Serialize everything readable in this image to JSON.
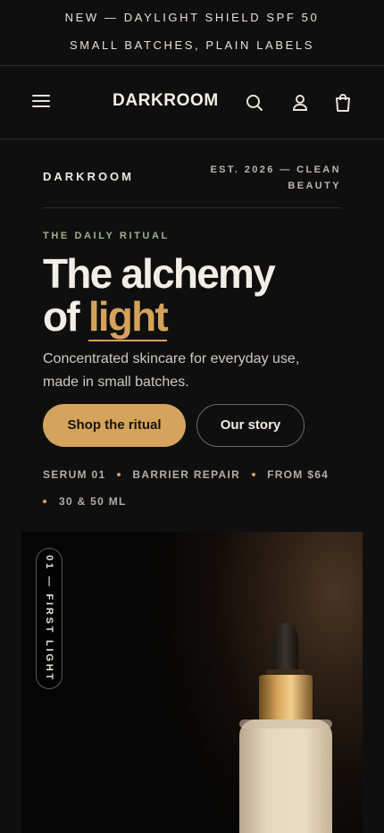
{
  "announcement": {
    "line1": "NEW — DAYLIGHT SHIELD SPF 50",
    "line2": "SMALL BATCHES, PLAIN LABELS"
  },
  "header": {
    "brand": "DARKROOM",
    "icons": [
      "menu-icon",
      "search-icon",
      "account-icon",
      "bag-icon"
    ]
  },
  "intro": {
    "subbrand": "DARKROOM",
    "est": "EST. 2026 — CLEAN BEAUTY"
  },
  "hero": {
    "eyebrow": "THE DAILY RITUAL",
    "headline_line1": "The alchemy",
    "headline_of": "of",
    "headline_accent": "light",
    "lead": "Concentrated skincare for everyday use, made in small batches.",
    "primary_cta": "Shop the ritual",
    "secondary_cta": "Our story",
    "meta": [
      "SERUM 01",
      "BARRIER REPAIR",
      "FROM $64",
      "30 & 50 ML"
    ]
  },
  "visual": {
    "tag": "01 — FIRST LIGHT"
  },
  "colors": {
    "background": "#0f0f10",
    "accent": "#d6a15a",
    "eyebrow": "#9db28c",
    "text": "#f1ece2"
  }
}
